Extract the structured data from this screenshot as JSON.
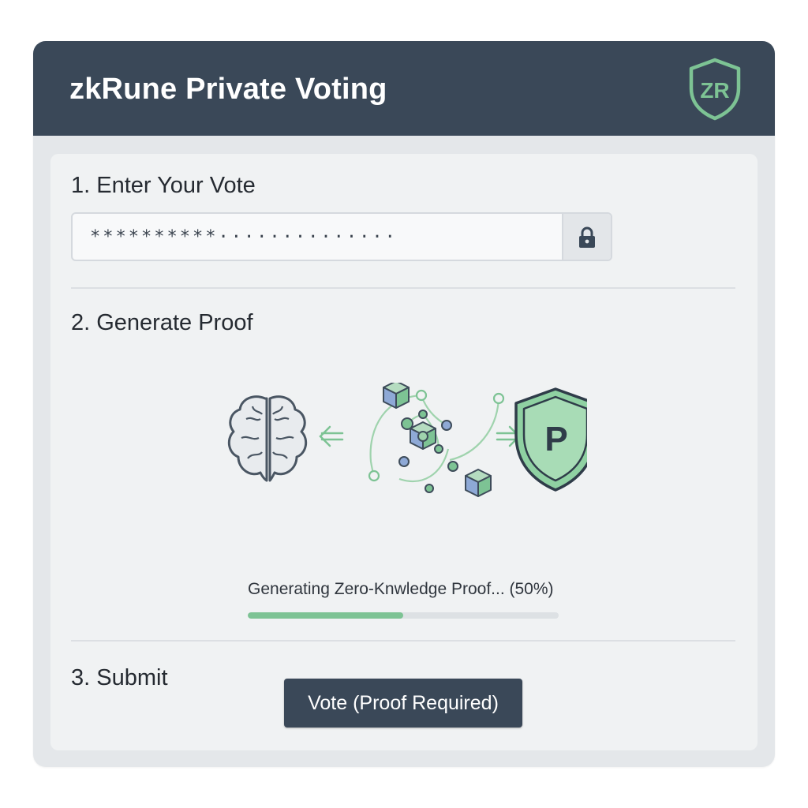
{
  "header": {
    "title": "zkRune Private Voting",
    "logo_text": "ZR"
  },
  "step1": {
    "title": "1. Enter Your Vote",
    "vote_value": "**********··············",
    "lock_icon": "lock-icon"
  },
  "step2": {
    "title": "2. Generate Proof",
    "shield_letter": "P",
    "icons": [
      "brain-icon",
      "left-arrow-icon",
      "network-cubes-icon",
      "right-arrow-icon",
      "shield-icon"
    ],
    "progress_label": "Generating Zero-Knwledge Proof... (50%)",
    "progress": 0.5
  },
  "step3": {
    "title": "3. Submit",
    "button_label": "Vote (Proof Required)"
  },
  "colors": {
    "header_bg": "#3a4858",
    "accent_green": "#7dc394",
    "accent_blue": "#8ea9d6",
    "button_bg": "#3a4858"
  }
}
